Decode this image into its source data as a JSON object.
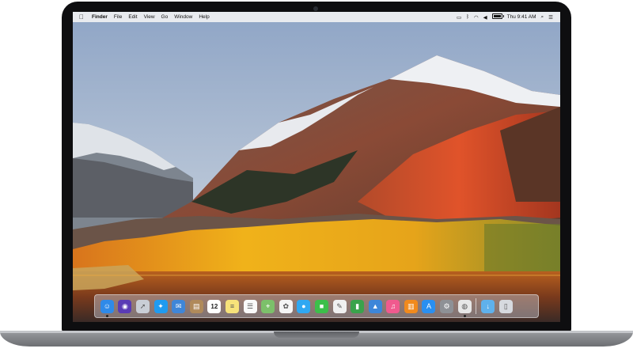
{
  "menubar": {
    "apple_icon": "apple-logo-icon",
    "app_name": "Finder",
    "menus": [
      "File",
      "Edit",
      "View",
      "Go",
      "Window",
      "Help"
    ],
    "status": {
      "display_icon": "airplay-icon",
      "bluetooth_icon": "bluetooth-icon",
      "wifi_icon": "wifi-icon",
      "volume_icon": "volume-icon",
      "battery_level": 1.0,
      "clock": "Thu 9:41 AM",
      "search_icon": "spotlight-search-icon",
      "menu_icon": "notification-center-icon"
    }
  },
  "dock": {
    "apps": [
      {
        "name": "Finder",
        "icon": "finder-icon",
        "color": "#2f8ae8",
        "running": true
      },
      {
        "name": "Siri",
        "icon": "siri-icon",
        "color": "#5a3bb5",
        "running": false
      },
      {
        "name": "Launchpad",
        "icon": "launchpad-rocket-icon",
        "color": "#c9ced6",
        "running": false
      },
      {
        "name": "Safari",
        "icon": "safari-compass-icon",
        "color": "#1f9bf0",
        "running": false
      },
      {
        "name": "Mail",
        "icon": "mail-stamp-icon",
        "color": "#3f86d8",
        "running": false
      },
      {
        "name": "Contacts",
        "icon": "contacts-book-icon",
        "color": "#b08a5a",
        "running": false
      },
      {
        "name": "Calendar",
        "icon": "calendar-icon",
        "color": "#ffffff",
        "running": false,
        "label": "12"
      },
      {
        "name": "Notes",
        "icon": "notes-icon",
        "color": "#f7e27a",
        "running": false
      },
      {
        "name": "Reminders",
        "icon": "reminders-icon",
        "color": "#fafafa",
        "running": false
      },
      {
        "name": "Maps",
        "icon": "maps-icon",
        "color": "#7cc06a",
        "running": false
      },
      {
        "name": "Photos",
        "icon": "photos-pinwheel-icon",
        "color": "#f5f5f5",
        "running": false
      },
      {
        "name": "Messages",
        "icon": "messages-bubble-icon",
        "color": "#2fa8f2",
        "running": false
      },
      {
        "name": "FaceTime",
        "icon": "facetime-camera-icon",
        "color": "#3cbf4a",
        "running": false
      },
      {
        "name": "Pages",
        "icon": "pages-icon",
        "color": "#f0f0f0",
        "running": false
      },
      {
        "name": "Numbers",
        "icon": "numbers-chart-icon",
        "color": "#3aa34b",
        "running": false
      },
      {
        "name": "Keynote",
        "icon": "keynote-podium-icon",
        "color": "#3d86d9",
        "running": false
      },
      {
        "name": "iTunes",
        "icon": "itunes-note-icon",
        "color": "#f05a8e",
        "running": false
      },
      {
        "name": "iBooks",
        "icon": "ibooks-icon",
        "color": "#f18a1d",
        "running": false
      },
      {
        "name": "App Store",
        "icon": "app-store-icon",
        "color": "#2a8ff0",
        "running": false
      },
      {
        "name": "System Preferences",
        "icon": "system-preferences-gear-icon",
        "color": "#8e9196",
        "running": false
      },
      {
        "name": "Chrome",
        "icon": "chrome-icon",
        "color": "#e7e7e7",
        "running": true
      }
    ],
    "stacks": [
      {
        "name": "Downloads",
        "icon": "downloads-folder-icon",
        "color": "#5fb1ec"
      },
      {
        "name": "Trash",
        "icon": "trash-icon",
        "color": "#d7dadf"
      }
    ]
  }
}
